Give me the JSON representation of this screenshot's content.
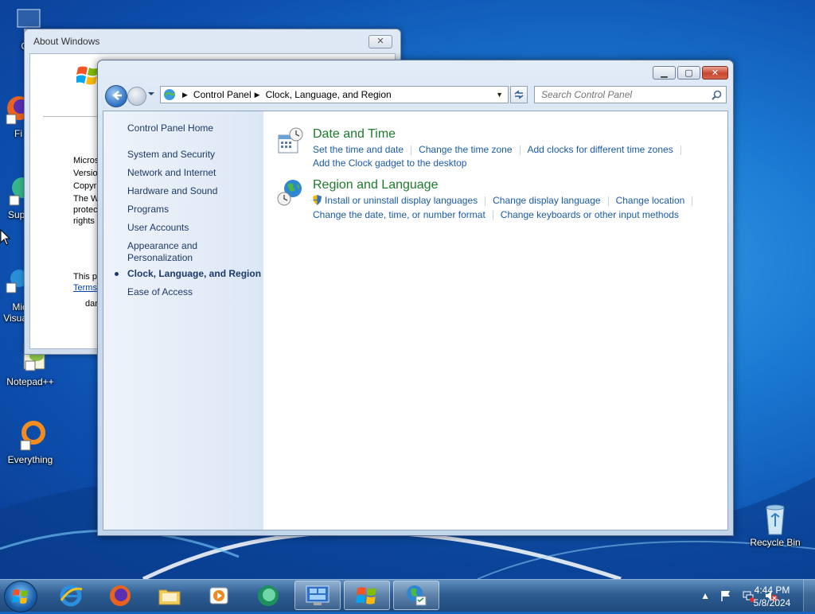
{
  "desktop": {
    "icons": [
      {
        "label": "Cor"
      },
      {
        "label": "Fi"
      },
      {
        "label": "Supe"
      },
      {
        "label": "Mic Visua"
      },
      {
        "label": "Notepad++"
      },
      {
        "label": "Everything"
      },
      {
        "label": "Recycle Bin"
      }
    ]
  },
  "about_dialog": {
    "title": "About Windows",
    "close_label": "✕",
    "lines": [
      "Microso",
      "Version",
      "Copyri",
      "The W",
      "protec",
      "rights i"
    ],
    "line2": "This pr",
    "terms_link": "Terms",
    "user": "dar"
  },
  "control_panel": {
    "caption_buttons": {
      "minimize": "▁",
      "maximize": "▢",
      "close": "✕"
    },
    "address": {
      "crumbs": [
        "Control Panel",
        "Clock, Language, and Region"
      ]
    },
    "search": {
      "placeholder": "Search Control Panel"
    },
    "left_nav": {
      "home": "Control Panel Home",
      "items": [
        "System and Security",
        "Network and Internet",
        "Hardware and Sound",
        "Programs",
        "User Accounts",
        "Appearance and Personalization",
        "Clock, Language, and Region",
        "Ease of Access"
      ],
      "active_index": 6
    },
    "categories": [
      {
        "heading": "Date and Time",
        "links": [
          "Set the time and date",
          "Change the time zone",
          "Add clocks for different time zones",
          "Add the Clock gadget to the desktop"
        ]
      },
      {
        "heading": "Region and Language",
        "links": [
          "Install or uninstall display languages",
          "Change display language",
          "Change location",
          "Change the date, time, or number format",
          "Change keyboards or other input methods"
        ]
      }
    ]
  },
  "taskbar": {
    "clock_time": "4:44 PM",
    "clock_date": "5/8/2024",
    "tray_up_arrow": "▲"
  },
  "colors": {
    "link": "#1a5ba8",
    "category_heading": "#1e7a2c",
    "nav_text": "#1c3a66"
  }
}
